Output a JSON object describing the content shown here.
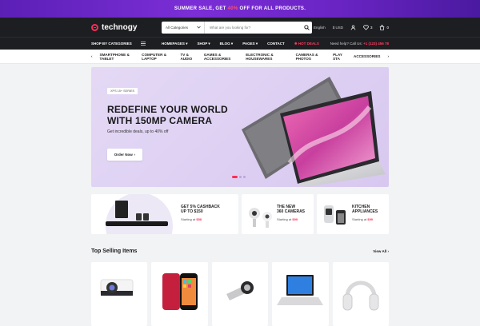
{
  "promo": {
    "before": "SUMMER SALE, GET ",
    "highlight": "40%",
    "after": " OFF FOR ALL PRODUCTS."
  },
  "header": {
    "logo": "technogy",
    "category_select": "All Categories",
    "search_placeholder": "What are you looking for?",
    "language": "English",
    "currency": "$ USD",
    "wishlist_count": "3",
    "cart_count": "0"
  },
  "nav": {
    "shop_by": "SHOP BY CATEGORIES",
    "items": [
      "HOMEPAGES",
      "SHOP",
      "BLOG",
      "PAGES",
      "CONTACT"
    ],
    "hot": "HOT DEALS",
    "help_label": "Need help? Call Us:",
    "help_phone": "+1 (123) 456 78"
  },
  "categories": [
    "SMARTPHONE & TABLET",
    "COMPUTER & LAPTOP",
    "TV & AUDIO",
    "GAMES & ACCESSORIES",
    "ELECTRONIC & HOUSEWARES",
    "CAMERAS & PHOTOS",
    "PLAY STA",
    "ACCESSORIES"
  ],
  "hero": {
    "tag": "XPS 15+ SERIES",
    "title_line1": "REDEFINE YOUR WORLD",
    "title_line2": "WITH 150MP CAMERA",
    "subtitle": "Get incredible deals, up to 40% off",
    "button": "Order Now"
  },
  "promo_cards": [
    {
      "title_line1": "GET 5% CASHBACK",
      "title_line2": "UP TO $150",
      "starting_label": "Starting at",
      "price": "$58"
    },
    {
      "title_line1": "THE NEW",
      "title_line2": "360 CAMERAS",
      "starting_label": "Starting at",
      "price": "$99"
    },
    {
      "title_line1": "KITCHEN",
      "title_line2": "APPLIANCES",
      "starting_label": "Starting at",
      "price": "$99"
    }
  ],
  "top_selling": {
    "title": "Top Selling Items",
    "view_all": "View All"
  },
  "colors": {
    "accent": "#ff2d55",
    "dark": "#1d1e22",
    "hero_bg": "#ddd0f2"
  }
}
